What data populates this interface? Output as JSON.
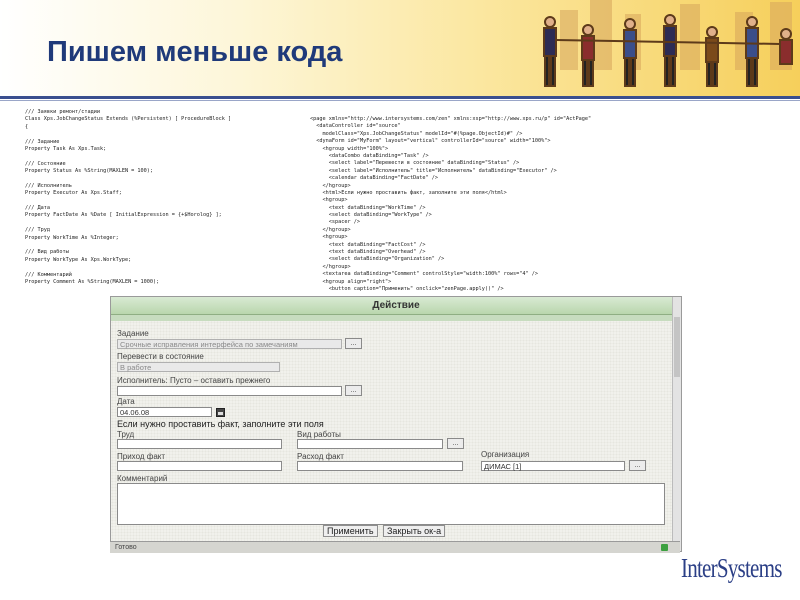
{
  "slide": {
    "title": "Пишем меньше кода",
    "logo": "InterSystems"
  },
  "code_left": [
    "/// Заявки ремонт/стадии",
    "Class Xps.JobChangeStatus Extends (%Persistent) [ ProcedureBlock ]",
    "{",
    "",
    "/// Задание",
    "Property Task As Xps.Task;",
    "",
    "/// Состояние",
    "Property Status As %String(MAXLEN = 100);",
    "",
    "/// Исполнитель",
    "Property Executor As Xps.Staff;",
    "",
    "/// Дата",
    "Property FactDate As %Date [ InitialExpression = {+$Horolog} ];",
    "",
    "/// Труд",
    "Property WorkTime As %Integer;",
    "",
    "/// Вид работы",
    "Property WorkType As Xps.WorkType;",
    "",
    "/// Комментарий",
    "Property Comment As %String(MAXLEN = 1000);"
  ],
  "code_right": [
    "<page xmlns=\"http://www.intersystems.com/zen\" xmlns:xsp=\"http://www.xps.ru/p\" id=\"ActPage\"",
    "  <dataController id=\"source\"",
    "    modelClass=\"Xps.JobChangeStatus\" modelId=\"#(%page.ObjectId)#\" />",
    "  <dynaForm id=\"MyForm\" layout=\"vertical\" controllerId=\"source\" width=\"100%\">",
    "    <hgroup width=\"100%\">",
    "      <dataCombo dataBinding=\"Task\" />",
    "      <select label=\"Перевести в состояние\" dataBinding=\"Status\" />",
    "      <select label=\"Исполнитель\" title=\"Исполнитель\" dataBinding=\"Executor\" />",
    "      <calendar dataBinding=\"FactDate\" />",
    "    </hgroup>",
    "    <html>Если нужно проставить факт, заполните эти поля</html>",
    "    <hgroup>",
    "      <text dataBinding=\"WorkTime\" />",
    "      <select dataBinding=\"WorkType\" />",
    "      <spacer />",
    "    </hgroup>",
    "    <hgroup>",
    "      <text dataBinding=\"FactCost\" />",
    "      <text dataBinding=\"Overhead\" />",
    "      <select dataBinding=\"Organization\" />",
    "    </hgroup>",
    "    <textarea dataBinding=\"Comment\" controlStyle=\"width:100%\" rows=\"4\" />",
    "    <hgroup align=\"right\">",
    "      <button caption=\"Применить\" onclick=\"zenPage.apply()\" />"
  ],
  "dialog": {
    "title": "Действие",
    "task_label": "Задание",
    "task_value": "Срочные исправления интерфейса по замечаниям",
    "status_label": "Перевести в состояние",
    "status_value": "В работе",
    "executor_label": "Исполнитель: Пусто – оставить прежнего",
    "date_label": "Дата",
    "date_value": "04.06.08",
    "fact_note": "Если нужно проставить факт, заполните эти поля",
    "work_label": "Труд",
    "worktype_label": "Вид работы",
    "factcost_label": "Приход факт",
    "expense_label": "Расход факт",
    "org_label": "Организация",
    "org_value": "ДИМАС [1]",
    "comment_label": "Комментарий",
    "dots": "...",
    "apply_button": "Применить",
    "close_button": "Закрыть ок-а"
  },
  "statusbar": {
    "text": "Готово"
  },
  "colors": {
    "title": "#1f3a7a",
    "dialog_header": "#c7dcbf",
    "logo": "#2b3f86"
  }
}
